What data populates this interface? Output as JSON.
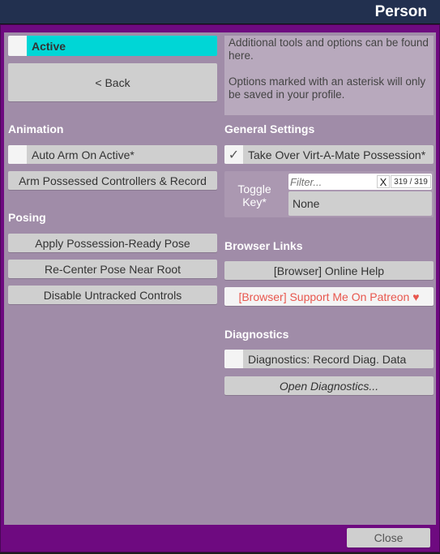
{
  "header": {
    "title": "Person"
  },
  "left": {
    "active_label": "Active",
    "active_checked": false,
    "active_color": "#00d6d6",
    "back_label": "< Back",
    "animation": {
      "heading": "Animation",
      "auto_arm": "Auto Arm On Active*",
      "auto_arm_checked": false,
      "arm_record": "Arm Possessed Controllers & Record"
    },
    "posing": {
      "heading": "Posing",
      "items": [
        "Apply Possession-Ready Pose",
        "Re-Center Pose Near Root",
        "Disable Untracked Controls"
      ]
    }
  },
  "right": {
    "info_line1": "Additional tools and options can be found here.",
    "info_line2": "Options marked with an asterisk will only be saved in your profile.",
    "general": {
      "heading": "General Settings",
      "takeover": "Take Over Virt-A-Mate Possession*",
      "takeover_checked": true,
      "toggle_key_label": "Toggle Key*",
      "filter_placeholder": "Filter...",
      "clear": "X",
      "count": "319 / 319",
      "selected": "None"
    },
    "links": {
      "heading": "Browser Links",
      "help": "[Browser] Online Help",
      "patreon": "[Browser] Support Me On Patreon ♥",
      "patreon_color": "#e8574e"
    },
    "diag": {
      "heading": "Diagnostics",
      "record": "Diagnostics: Record Diag. Data",
      "record_checked": false,
      "open": "Open Diagnostics..."
    }
  },
  "footer": {
    "close": "Close"
  }
}
